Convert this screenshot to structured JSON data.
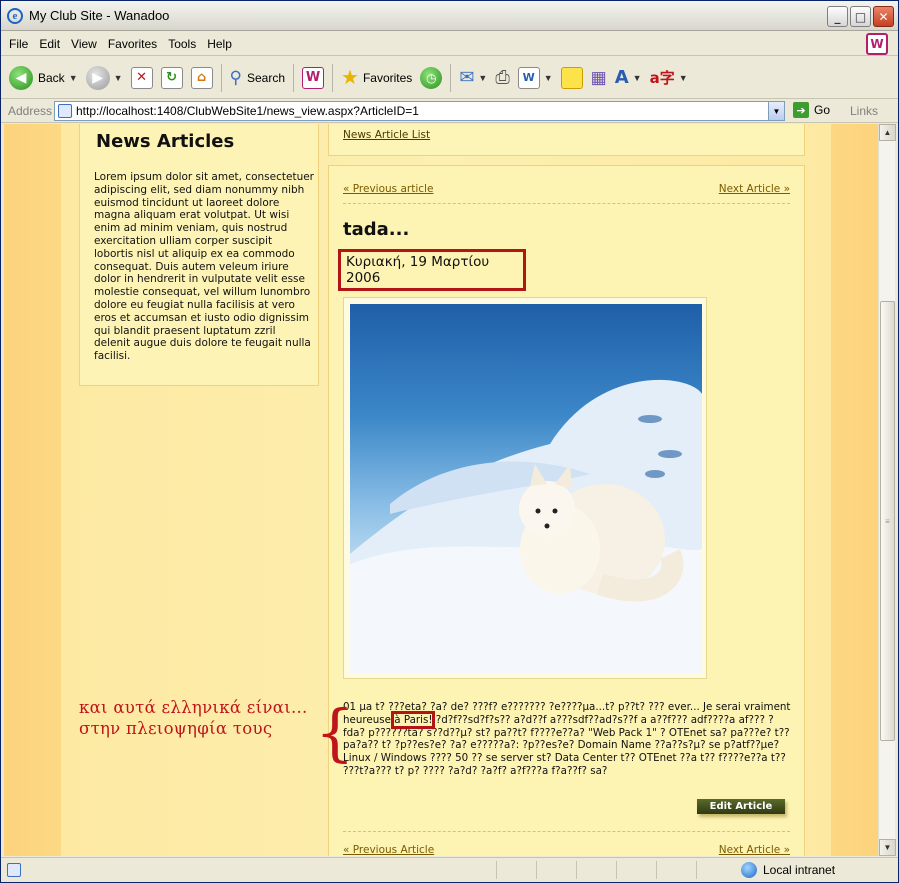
{
  "window": {
    "title": "My Club Site - Wanadoo"
  },
  "menu": [
    "File",
    "Edit",
    "View",
    "Favorites",
    "Tools",
    "Help"
  ],
  "toolbar": {
    "back_label": "Back",
    "search_label": "Search",
    "favorites_label": "Favorites"
  },
  "address": {
    "label": "Address",
    "url": "http://localhost:1408/ClubWebSite1/news_view.aspx?ArticleID=1",
    "go_label": "Go",
    "links_label": "Links"
  },
  "sidebar": {
    "heading": "News Articles",
    "text": "Lorem ipsum dolor sit amet, consectetuer adipiscing elit, sed diam nonummy nibh euismod tincidunt ut laoreet dolore magna aliquam erat volutpat. Ut wisi enim ad minim veniam, quis nostrud exercitation ulliam corper suscipit lobortis nisl ut aliquip ex ea commodo consequat. Duis autem veleum iriure dolor in hendrerit in vulputate velit esse molestie consequat, vel willum lunombro dolore eu feugiat nulla facilisis at vero eros et accumsan et iusto odio dignissim qui blandit praesent luptatum zzril delenit augue duis dolore te feugait nulla facilisi."
  },
  "article": {
    "list_link": "News Article List",
    "prev_top": "« Previous article",
    "next_top": "Next Article »",
    "title": "tada...",
    "date": "Κυριακή, 19 Μαρτίου 2006",
    "body_before": "01 µa t? ???eta? ?a? de? ???f? e??????? ?e????µa...t? p??t? ??? ever... Je serai vraiment heureuse ",
    "body_highlight": "à Paris!",
    "body_after": " ?d?f??sd?f?s?? a?d??f a???sdf??ad?s??f a a??f??? adf????a af??? ?fda? p??????ta? s??d??µ? st? pa??t? f????e??a? \"Web Pack 1\" ? OTEnet sa? pa???e? t?? pa?a?? t? ?p??es?e? ?a? e?????a?: ?p??es?e? Domain Name ??a??s?µ? se p?atf??µe? Linux / Windows ???? 50 ?? se server st? Data Center t?? OTEnet ??a t?? f????e??a t?? ???t?a??? t? p? ???? ?a?d? ?a?f? a?f???a f?a??f? sa?",
    "edit_button": "Edit Article",
    "prev_bottom": "« Previous Article",
    "next_bottom": "Next Article »"
  },
  "annotation": {
    "line1": "και αυτά ελληνικά είναι...",
    "line2": "στην πλειοψηφία τους"
  },
  "status": {
    "zone": "Local intranet"
  }
}
